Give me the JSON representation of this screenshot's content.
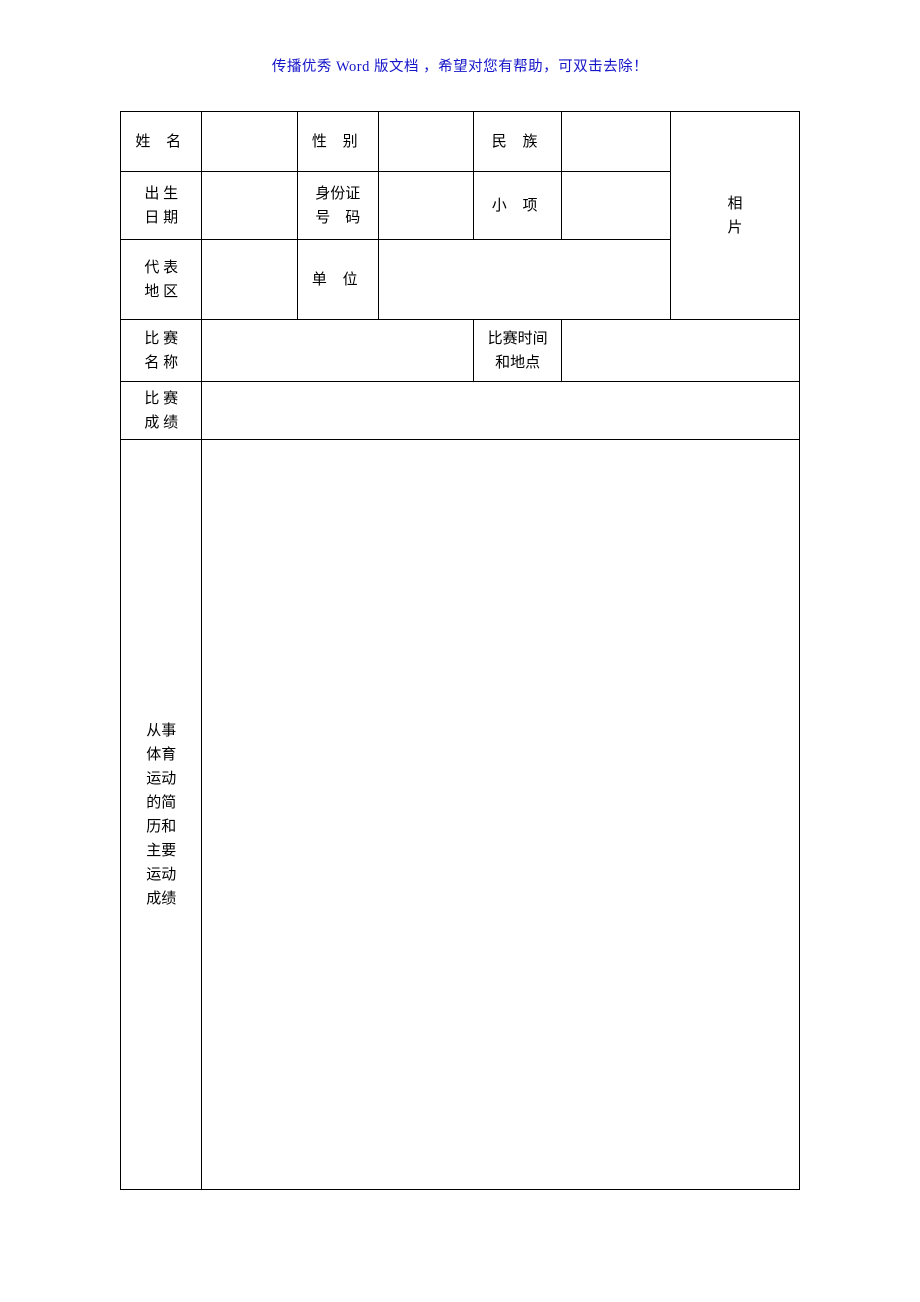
{
  "header_note": "传播优秀 Word 版文档 ，希望对您有帮助，可双击去除！",
  "labels": {
    "name": "姓 名",
    "gender": "性 别",
    "ethnicity": "民 族",
    "birth_date_l1": "出 生",
    "birth_date_l2": "日 期",
    "id_l1": "身份证",
    "id_l2": "号　码",
    "sub_event": "小 项",
    "region_l1": "代 表",
    "region_l2": "地 区",
    "unit": "单 位",
    "photo_l1": "相",
    "photo_l2": "片",
    "comp_name_l1": "比 赛",
    "comp_name_l2": "名 称",
    "comp_time_l1": "比赛时间",
    "comp_time_l2": "和地点",
    "comp_result_l1": "比 赛",
    "comp_result_l2": "成 绩",
    "history_1": "从事",
    "history_2": "体育",
    "history_3": "运动",
    "history_4": "的简",
    "history_5": "历和",
    "history_6": "主要",
    "history_7": "运动",
    "history_8": "成绩"
  },
  "values": {
    "name": "",
    "gender": "",
    "ethnicity": "",
    "birth_date": "",
    "id_number": "",
    "sub_event": "",
    "region": "",
    "unit": "",
    "comp_name": "",
    "comp_time_place": "",
    "comp_result": "",
    "history": ""
  }
}
